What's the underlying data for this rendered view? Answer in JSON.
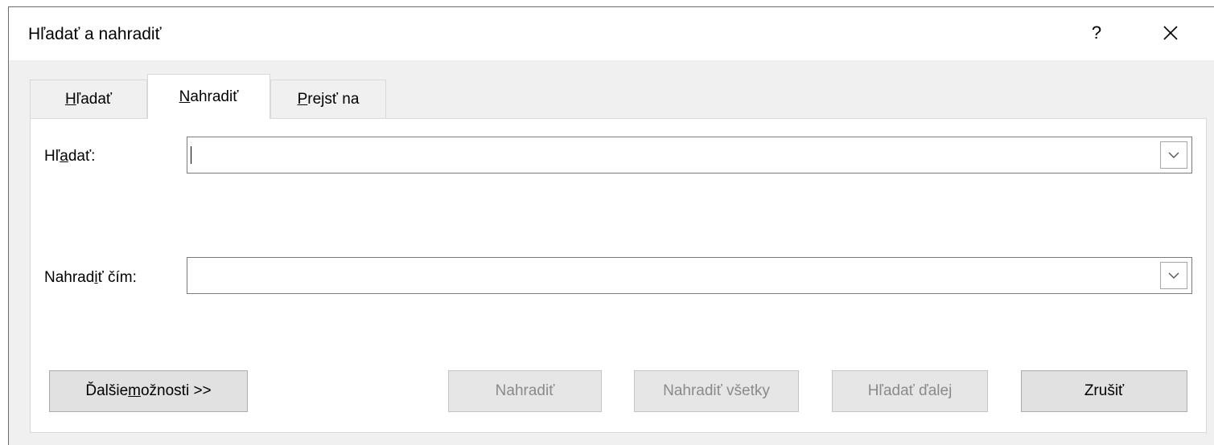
{
  "dialog": {
    "title": "Hľadať a nahradiť",
    "help_label": "?"
  },
  "tabs": [
    {
      "pre": "",
      "key": "H",
      "post": "ľadať"
    },
    {
      "pre": "",
      "key": "N",
      "post": "ahradiť"
    },
    {
      "pre": "",
      "key": "P",
      "post": "rejsť na"
    }
  ],
  "active_tab": "Nahradiť",
  "find": {
    "label_pre": "Hľ",
    "label_key": "a",
    "label_post": "dať:",
    "value": ""
  },
  "replace": {
    "label_pre": "Nahrad",
    "label_key": "i",
    "label_post": "ť čím:",
    "value": ""
  },
  "buttons": {
    "more_pre": "Ďalšie ",
    "more_key": "m",
    "more_post": "ožnosti >>",
    "replace": "Nahradiť",
    "replace_all": "Nahradiť všetky",
    "find_next": "Hľadať ďalej",
    "cancel": "Zrušiť"
  },
  "colors": {
    "dialog_bg": "#f0f0f0",
    "panel_bg": "#ffffff",
    "button_bg": "#e1e1e1",
    "disabled_text": "#8a8a8a"
  },
  "icons": {
    "close": "close-icon",
    "dropdown": "chevron-down-icon"
  }
}
